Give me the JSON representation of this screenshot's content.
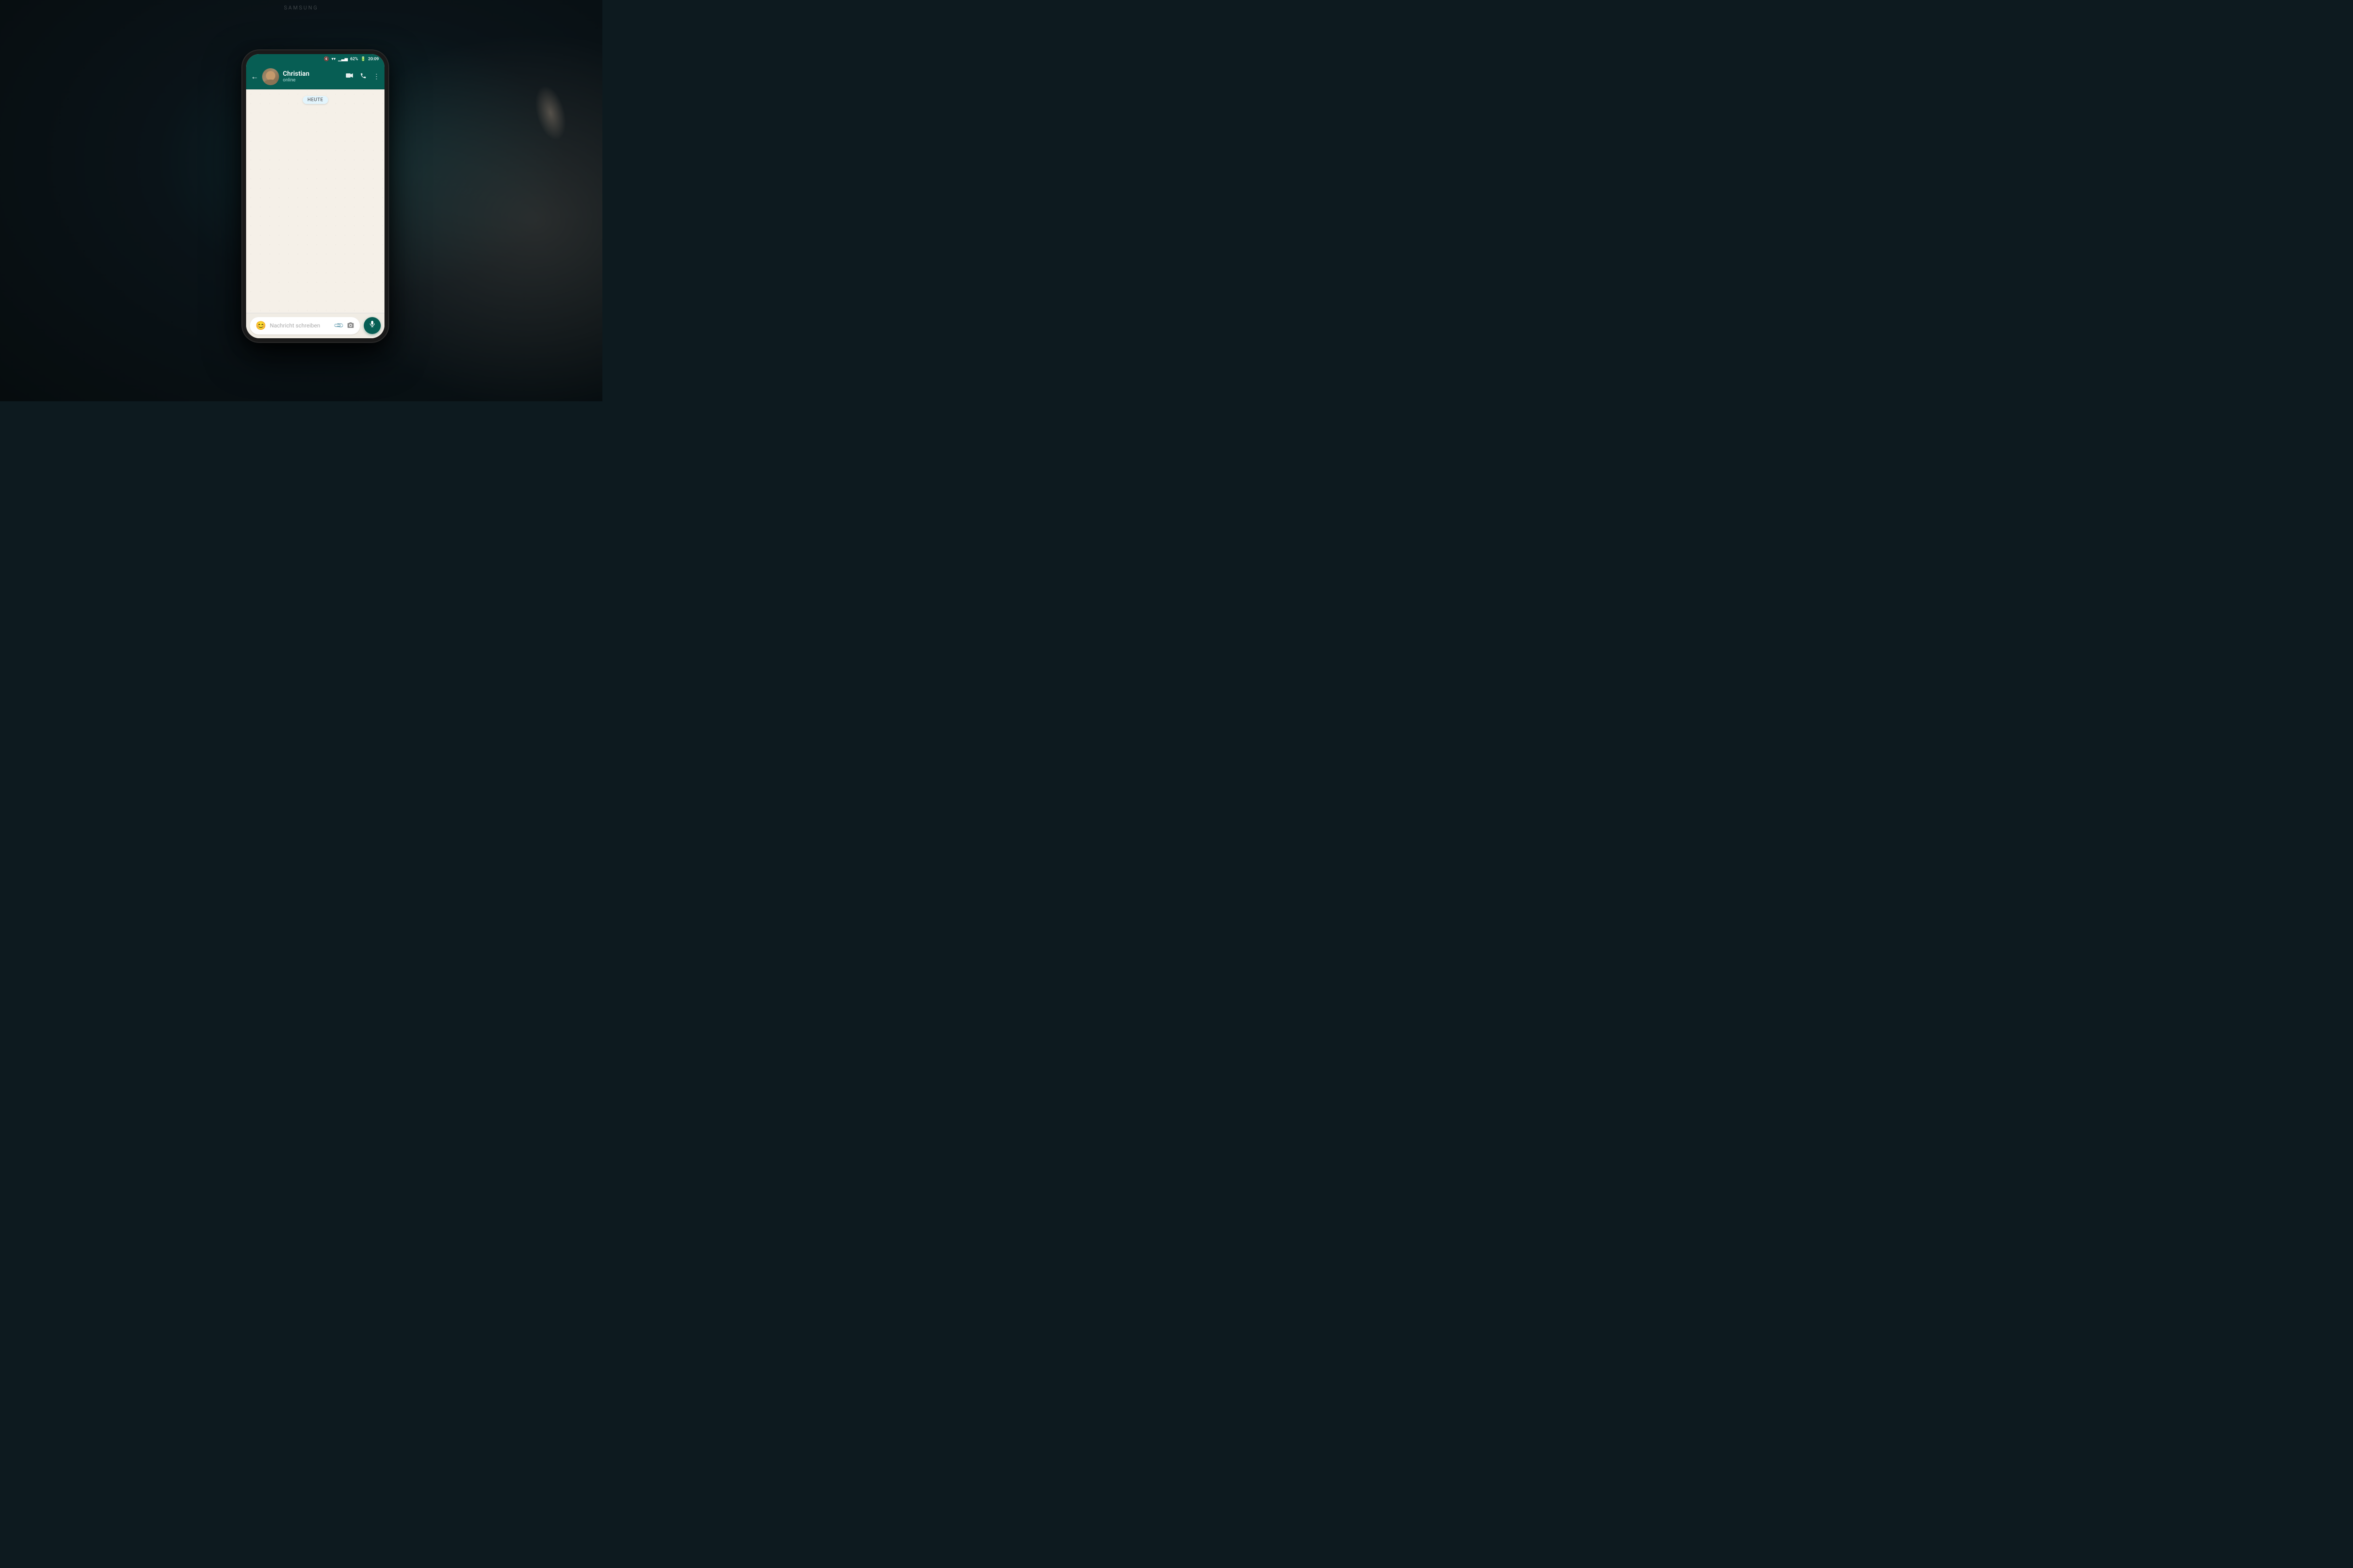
{
  "background": {
    "color": "#0d1a1f"
  },
  "device": {
    "brand": "SAMSUNG"
  },
  "status_bar": {
    "mute_icon": "🔇",
    "wifi_icon": "wifi",
    "signal_icon": "signal",
    "battery": "62%",
    "time": "20:09"
  },
  "chat_header": {
    "back_label": "←",
    "contact_name": "Christian",
    "contact_status": "online",
    "video_call_icon": "video",
    "phone_icon": "phone",
    "menu_icon": "more"
  },
  "chat_body": {
    "date_badge": "HEUTE",
    "background_color": "#f5f0e8"
  },
  "input_bar": {
    "emoji_icon": "😊",
    "placeholder": "Nachricht schreiben",
    "attach_icon": "📎",
    "camera_icon": "📷",
    "mic_icon": "🎤",
    "mic_button_color": "#075e54"
  }
}
